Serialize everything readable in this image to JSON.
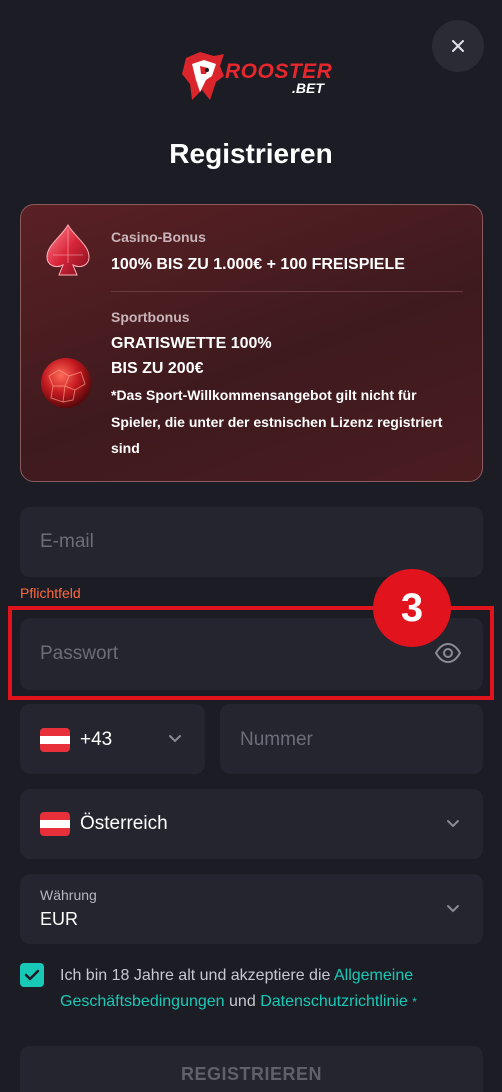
{
  "brand": {
    "name": "ROOSTER",
    "suffix": ".BET",
    "color": "#e8272d"
  },
  "modal": {
    "title": "Registrieren",
    "close_icon": "close-icon"
  },
  "bonus": {
    "casino": {
      "label": "Casino-Bonus",
      "title": "100% BIS ZU 1.000€ + 100 FREISPIELE",
      "icon": "spade-gem-icon"
    },
    "sport": {
      "label": "Sportbonus",
      "title_line1": "GRATISWETTE 100%",
      "title_line2": "BIS ZU 200€",
      "note_line1": "*Das Sport-Willkommensangebot gilt nicht für",
      "note_line2": "Spieler, die unter der estnischen Lizenz registriert",
      "note_line3": "sind",
      "icon": "red-ball-icon"
    }
  },
  "form": {
    "email": {
      "placeholder": "E-mail"
    },
    "required_label": "Pflichtfeld",
    "password": {
      "placeholder": "Passwort",
      "toggle_icon": "eye-icon"
    },
    "phone": {
      "country_code": "+43",
      "placeholder": "Nummer",
      "flag": "austria-flag-icon"
    },
    "country": {
      "value": "Österreich",
      "flag": "austria-flag-icon"
    },
    "currency": {
      "label": "Währung",
      "value": "EUR"
    },
    "terms": {
      "checked": true,
      "text_before": "Ich bin 18 Jahre alt und akzeptiere die",
      "link_terms": "Allgemeine Geschäftsbedingungen",
      "text_and": "und",
      "link_privacy": "Datenschutzrichtlinie",
      "required_mark": "*"
    },
    "submit_label": "REGISTRIEREN"
  },
  "annotation": {
    "step": "3",
    "color": "#e1141e"
  },
  "colors": {
    "background": "#1b1c24",
    "field": "#24252e",
    "accent": "#19c9b8",
    "error": "#ff6a3d"
  }
}
